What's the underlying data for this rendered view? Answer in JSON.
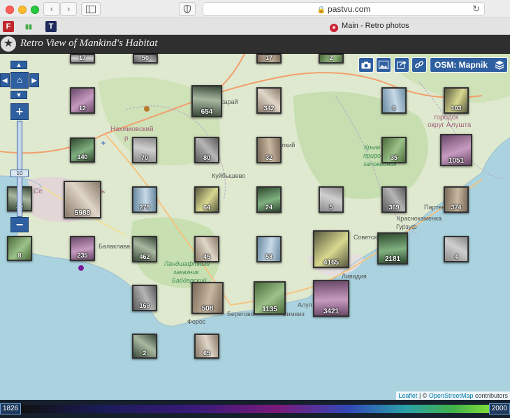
{
  "browser": {
    "url": "pastvu.com",
    "tab_title": "Main - Retro photos",
    "back_icon": "‹",
    "forward_icon": "›"
  },
  "site": {
    "title": "Retro View of Mankind's Habitat"
  },
  "map": {
    "layer_button": "OSM: Mapnik",
    "zoom_level": "10",
    "attribution": {
      "leaflet": "Leaflet",
      "sep": " | © ",
      "osm": "OpenStreetMap",
      "suffix": " contributors"
    },
    "labels": {
      "nakhimovsky": "Нахимовский",
      "ra": "р",
      "kuibyshevo": "Куйбышево",
      "balaklava": "Балаклава",
      "sevastopol_frag": "Се",
      "sevastopol_frag2": "ь",
      "landscape1": "Ландшафтный",
      "landscape2": "заказник",
      "landscape3": "Байдарский",
      "foros": "Форос",
      "beregovoe": "Берегово",
      "simeiz": "Симеиз",
      "alupka": "Алуп",
      "livadia": "Ливадия",
      "sovetskoe": "Советско",
      "krasnokamenka": "Краснокаменка",
      "gurzuf": "Гурзуф",
      "partenit": "Партен",
      "krym1": "Крым",
      "krym2": "приро",
      "krym3": "заповедник",
      "gorsk1": "городск",
      "gorsk2": "округ Алушта",
      "bakh": "сарай",
      "bakh2": "лкий"
    },
    "clusters": [
      {
        "count": "17"
      },
      {
        "count": "50"
      },
      {
        "count": "17"
      },
      {
        "count": "2"
      },
      {
        "count": "12"
      },
      {
        "count": "654"
      },
      {
        "count": "342"
      },
      {
        "count": "6"
      },
      {
        "count": "103"
      },
      {
        "count": "140"
      },
      {
        "count": "70"
      },
      {
        "count": "80"
      },
      {
        "count": "32"
      },
      {
        "count": "35"
      },
      {
        "count": "1051"
      },
      {
        "count": "15"
      },
      {
        "count": "5988"
      },
      {
        "count": "278"
      },
      {
        "count": "64"
      },
      {
        "count": "24"
      },
      {
        "count": "5"
      },
      {
        "count": "369"
      },
      {
        "count": "374"
      },
      {
        "count": "8"
      },
      {
        "count": "235"
      },
      {
        "count": "462"
      },
      {
        "count": "45"
      },
      {
        "count": "58"
      },
      {
        "count": "4165"
      },
      {
        "count": "2181"
      },
      {
        "count": "4"
      },
      {
        "count": "169"
      },
      {
        "count": "508"
      },
      {
        "count": "1135"
      },
      {
        "count": "3421"
      },
      {
        "count": "2"
      },
      {
        "count": "65"
      }
    ]
  },
  "timeline": {
    "start_year": "1826",
    "end_year": "2000"
  }
}
